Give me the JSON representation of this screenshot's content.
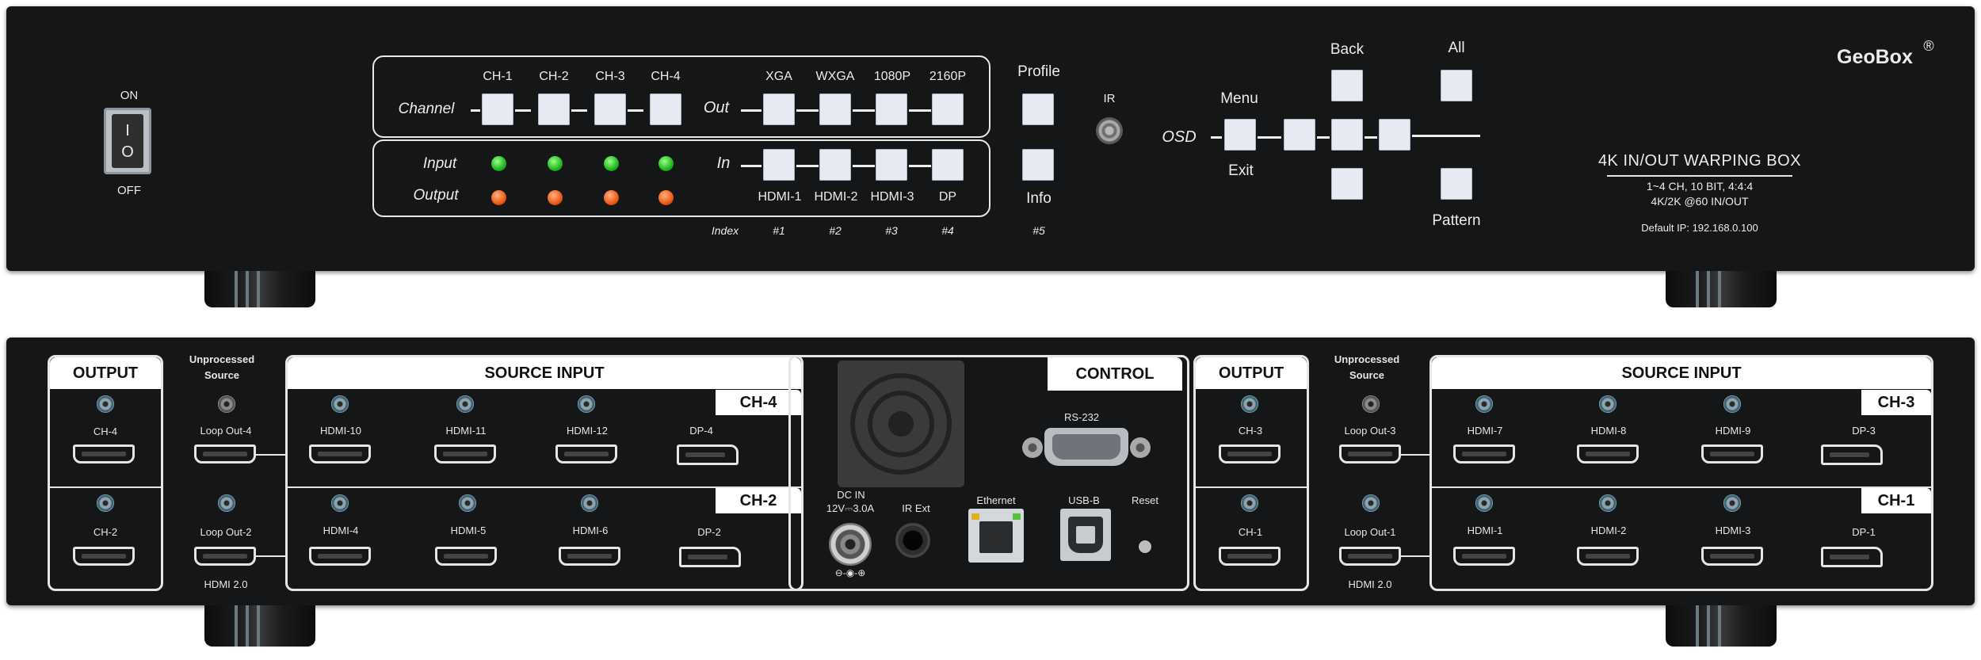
{
  "front": {
    "power": {
      "on_label": "ON",
      "off_label": "OFF",
      "rocker_top": "I",
      "rocker_bottom": "O"
    },
    "channel_label": "Channel",
    "channel_buttons": [
      "CH-1",
      "CH-2",
      "CH-3",
      "CH-4"
    ],
    "out_label": "Out",
    "out_buttons": [
      "XGA",
      "WXGA",
      "1080P",
      "2160P"
    ],
    "in_label": "In",
    "in_buttons": [
      "HDMI-1",
      "HDMI-2",
      "HDMI-3",
      "DP"
    ],
    "input_label": "Input",
    "output_label": "Output",
    "index_label": "Index",
    "index_values": [
      "#1",
      "#2",
      "#3",
      "#4",
      "#5"
    ],
    "profile_label": "Profile",
    "info_label": "Info",
    "ir_label": "IR",
    "osd_label": "OSD",
    "menu_label": "Menu",
    "exit_label": "Exit",
    "back_label": "Back",
    "all_label": "All",
    "pattern_label": "Pattern",
    "brand": "GeoBox",
    "brand_mark": "®",
    "product_title": "4K IN/OUT WARPING BOX",
    "spec_line1": "1~4 CH, 10 BIT, 4:4:4",
    "spec_line2": "4K/2K @60 IN/OUT",
    "default_ip": "Default IP: 192.168.0.100",
    "colors": {
      "input_led": "#1fb81c",
      "output_led": "#ef5a16",
      "button": "#e6eaf2"
    }
  },
  "back": {
    "left": {
      "output_header": "OUTPUT",
      "unprocessed_line1": "Unprocessed",
      "unprocessed_line2": "Source",
      "source_header": "SOURCE INPUT",
      "ch_tag_top": "CH-4",
      "ch_tag_bottom": "CH-2",
      "out_top": "CH-4",
      "out_bottom": "CH-2",
      "loop_top": "Loop Out-4",
      "loop_bottom": "Loop Out-2",
      "hdmi_version": "HDMI 2.0",
      "inputs_top": [
        "HDMI-10",
        "HDMI-11",
        "HDMI-12",
        "DP-4"
      ],
      "inputs_bottom": [
        "HDMI-4",
        "HDMI-5",
        "HDMI-6",
        "DP-2"
      ]
    },
    "control": {
      "header": "CONTROL",
      "rs232": "RS-232",
      "dc_in": "DC IN",
      "dc_spec": "12V⎓3.0A",
      "ir_ext": "IR Ext",
      "ethernet": "Ethernet",
      "usb": "USB-B",
      "reset": "Reset"
    },
    "right": {
      "output_header": "OUTPUT",
      "unprocessed_line1": "Unprocessed",
      "unprocessed_line2": "Source",
      "source_header": "SOURCE INPUT",
      "ch_tag_top": "CH-3",
      "ch_tag_bottom": "CH-1",
      "out_top": "CH-3",
      "out_bottom": "CH-1",
      "loop_top": "Loop Out-3",
      "loop_bottom": "Loop Out-1",
      "hdmi_version": "HDMI 2.0",
      "inputs_top": [
        "HDMI-7",
        "HDMI-8",
        "HDMI-9",
        "DP-3"
      ],
      "inputs_bottom": [
        "HDMI-1",
        "HDMI-2",
        "HDMI-3",
        "DP-1"
      ]
    }
  }
}
